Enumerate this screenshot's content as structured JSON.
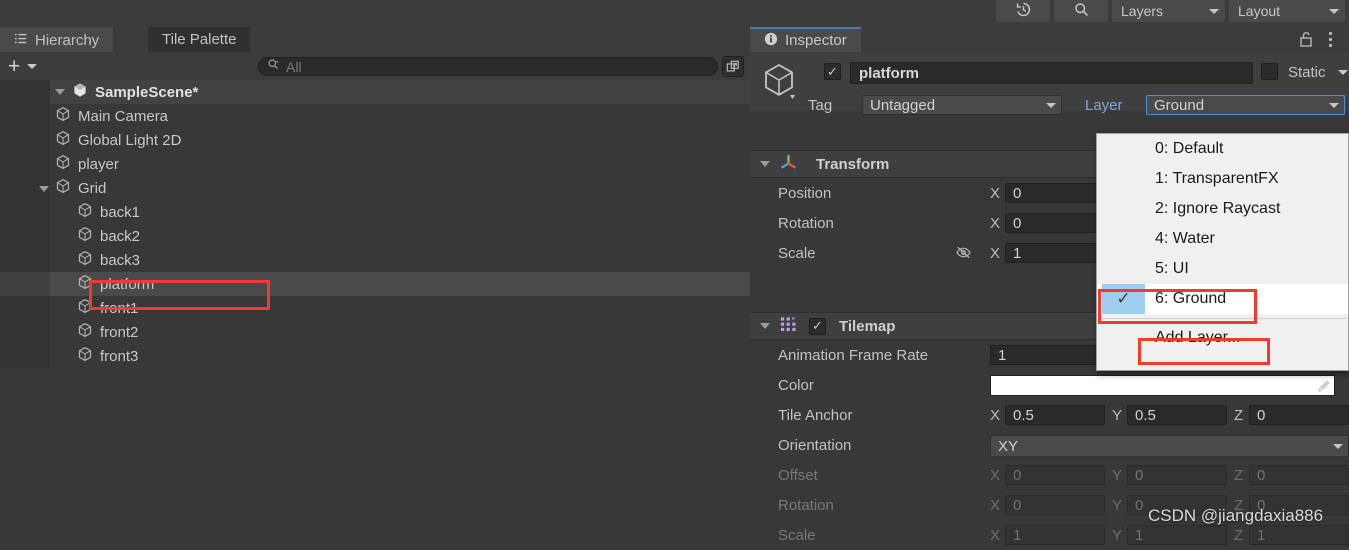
{
  "toolbar": {
    "history_icon": "history-icon",
    "search_icon": "search-icon",
    "layers_label": "Layers",
    "layout_label": "Layout"
  },
  "hierarchy": {
    "tabs": [
      {
        "label": "Hierarchy",
        "icon": "hierarchy-icon",
        "active": true
      },
      {
        "label": "Tile Palette",
        "icon": "",
        "active": false
      }
    ],
    "add_button": "+",
    "search": {
      "value": "",
      "placeholder": "All",
      "icon": "search-icon"
    },
    "scene": {
      "label": "SampleScene*",
      "expanded": true
    },
    "items": [
      {
        "label": "Main Camera",
        "depth": 2,
        "expandable": false,
        "selected": false
      },
      {
        "label": "Global Light 2D",
        "depth": 2,
        "expandable": false,
        "selected": false
      },
      {
        "label": "player",
        "depth": 2,
        "expandable": false,
        "selected": false
      },
      {
        "label": "Grid",
        "depth": 2,
        "expandable": true,
        "selected": false
      },
      {
        "label": "back1",
        "depth": 3,
        "expandable": false,
        "selected": false
      },
      {
        "label": "back2",
        "depth": 3,
        "expandable": false,
        "selected": false
      },
      {
        "label": "back3",
        "depth": 3,
        "expandable": false,
        "selected": false
      },
      {
        "label": "platform",
        "depth": 3,
        "expandable": false,
        "selected": true
      },
      {
        "label": "front1",
        "depth": 3,
        "expandable": false,
        "selected": false
      },
      {
        "label": "front2",
        "depth": 3,
        "expandable": false,
        "selected": false
      },
      {
        "label": "front3",
        "depth": 3,
        "expandable": false,
        "selected": false
      }
    ]
  },
  "inspector": {
    "tab_label": "Inspector",
    "lock_icon": "unlocked-padlock-icon",
    "menu_icon": "kebab-menu-icon",
    "object": {
      "enabled": true,
      "name": "platform",
      "static_label": "Static",
      "static_checked": false,
      "tag_label": "Tag",
      "tag_value": "Untagged",
      "layer_label": "Layer",
      "layer_value": "Ground"
    },
    "transform": {
      "title": "Transform",
      "icon": "transform-axis-icon",
      "expanded": true,
      "rows": [
        {
          "label": "Position",
          "x": "0",
          "locked_icon": false
        },
        {
          "label": "Rotation",
          "x": "0",
          "locked_icon": false
        },
        {
          "label": "Scale",
          "x": "1",
          "locked_icon": true
        }
      ]
    },
    "tilemap": {
      "title": "Tilemap",
      "icon": "tilemap-grid-icon",
      "enabled": true,
      "expanded": true,
      "animation_frame_rate": {
        "label": "Animation Frame Rate",
        "value": "1"
      },
      "color": {
        "label": "Color",
        "value": "#ffffff",
        "eyedropper_icon": "eyedropper-icon"
      },
      "tile_anchor": {
        "label": "Tile Anchor",
        "x": "0.5",
        "y": "0.5",
        "z": "0",
        "disabled": false
      },
      "orientation": {
        "label": "Orientation",
        "value": "XY"
      },
      "offset": {
        "label": "Offset",
        "x": "0",
        "y": "0",
        "z": "0",
        "disabled": true
      },
      "rotation": {
        "label": "Rotation",
        "x": "0",
        "y": "0",
        "z": "0",
        "disabled": true
      },
      "scale": {
        "label": "Scale",
        "x": "1",
        "y": "1",
        "z": "1",
        "disabled": true
      }
    }
  },
  "layer_menu": {
    "items": [
      {
        "label": "0: Default",
        "checked": false
      },
      {
        "label": "1: TransparentFX",
        "checked": false
      },
      {
        "label": "2: Ignore Raycast",
        "checked": false
      },
      {
        "label": "4: Water",
        "checked": false
      },
      {
        "label": "5: UI",
        "checked": false
      },
      {
        "label": "6: Ground",
        "checked": true
      }
    ],
    "add_layer_label": "Add Layer...",
    "check_glyph": "✓"
  },
  "watermark": "CSDN @jiangdaxia886",
  "colors": {
    "accent_blue": "#4a90d9",
    "annotation_red": "#f43a2e",
    "menu_highlight": "#9ecdf0",
    "panel_bg": "#383838"
  }
}
